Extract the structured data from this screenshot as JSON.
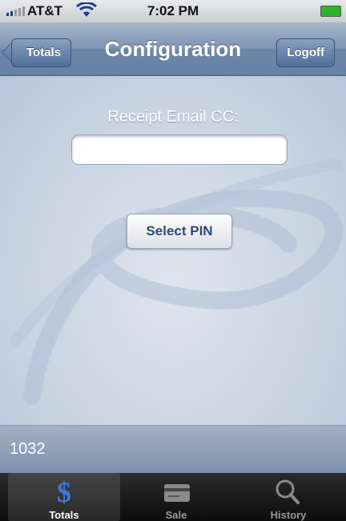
{
  "status_bar": {
    "carrier": "AT&T",
    "time": "7:02 PM",
    "signal_icon": "signal-bars-icon",
    "wifi_icon": "wifi-icon",
    "battery_icon": "battery-charging-icon"
  },
  "nav": {
    "title": "Configuration",
    "back_label": "Totals",
    "logoff_label": "Logoff"
  },
  "form": {
    "email_label": "Receipt Email CC:",
    "email_value": "",
    "email_placeholder": "",
    "select_pin_label": "Select PIN"
  },
  "info_bar": {
    "value": "1032"
  },
  "tabs": [
    {
      "label": "Totals",
      "icon": "dollar-icon",
      "active": true
    },
    {
      "label": "Sale",
      "icon": "credit-card-icon",
      "active": false
    },
    {
      "label": "History",
      "icon": "magnifier-icon",
      "active": false
    }
  ],
  "colors": {
    "nav_bar": "#7c93b3",
    "background": "#c9d3e2",
    "active_icon": "#3b7be0"
  }
}
